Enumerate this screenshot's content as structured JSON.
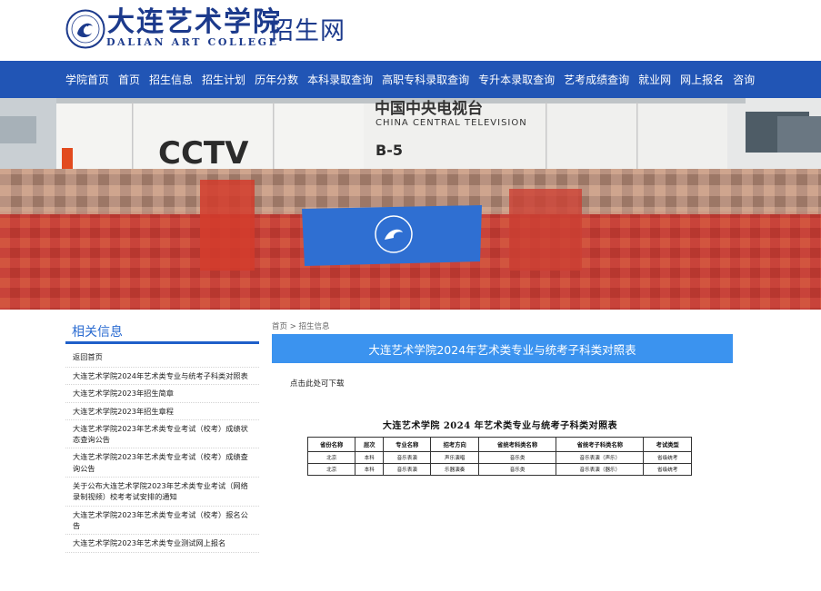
{
  "header": {
    "logo_name": "大连艺术学院",
    "logo_en": "DALIAN ART COLLEGE",
    "logo_sub": "招生网",
    "colors": {
      "brand": "#1c3a8c"
    }
  },
  "nav": {
    "bg_color": "#2155b5",
    "items": [
      "学院首页",
      "首页",
      "招生信息",
      "招生计划",
      "历年分数",
      "本科录取查询",
      "高职专科录取查询",
      "专升本录取查询",
      "艺考成绩查询",
      "就业网",
      "网上报名",
      "咨询"
    ]
  },
  "banner": {
    "cctv_cn": "中国中央电视台",
    "cctv_en": "CHINA CENTRAL TELEVISION",
    "cctv_logo": "CCTV",
    "truck_no": "B-5"
  },
  "sidebar": {
    "title": "相关信息",
    "items": [
      "返回首页",
      "大连艺术学院2024年艺术类专业与统考子科类对照表",
      "大连艺术学院2023年招生简章",
      "大连艺术学院2023年招生章程",
      "大连艺术学院2023年艺术类专业考试（校考）成绩状态查询公告",
      "大连艺术学院2023年艺术类专业考试（校考）成绩查询公告",
      "关于公布大连艺术学院2023年艺术类专业考试（网络录制视频）校考考试安排的通知",
      "大连艺术学院2023年艺术类专业考试（校考）报名公告",
      "大连艺术学院2023年艺术类专业测试网上报名"
    ]
  },
  "main": {
    "breadcrumb": [
      "首页",
      "招生信息"
    ],
    "breadcrumb_sep": ">",
    "title": "大连艺术学院2024年艺术类专业与统考子科类对照表",
    "download_text": "点击此处可下载",
    "doc": {
      "title": "大连艺术学院 2024 年艺术类专业与统考子科类对照表",
      "headers": [
        "省份名称",
        "层次",
        "专业名称",
        "招考方向",
        "省统考科类名称",
        "省统考子科类名称",
        "考试类型"
      ],
      "rows": [
        [
          "北京",
          "本科",
          "音乐表演",
          "声乐演唱",
          "音乐类",
          "音乐表演（声乐）",
          "省级统考"
        ],
        [
          "北京",
          "本科",
          "音乐表演",
          "乐器演奏",
          "音乐类",
          "音乐表演（器乐）",
          "省级统考"
        ]
      ]
    }
  }
}
